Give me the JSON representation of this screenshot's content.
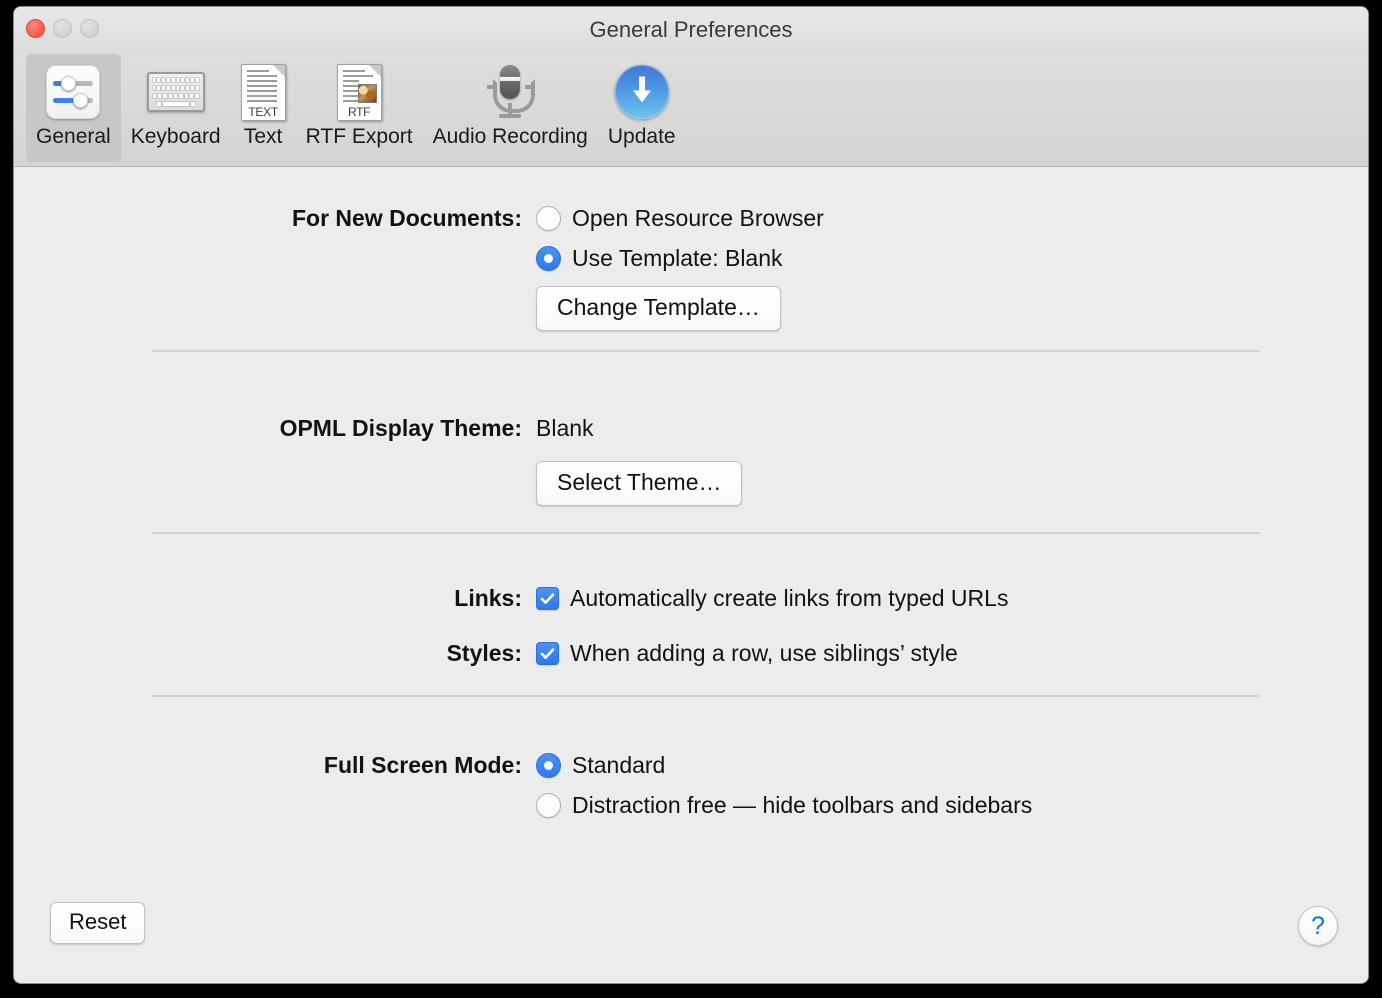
{
  "window": {
    "title": "General Preferences",
    "traffic_lights": [
      {
        "name": "close",
        "state": "active"
      },
      {
        "name": "minimize",
        "state": "disabled"
      },
      {
        "name": "zoom",
        "state": "disabled"
      }
    ]
  },
  "toolbar": {
    "selected": "General",
    "tabs": [
      {
        "label": "General",
        "icon": "sliders-icon",
        "selected": true
      },
      {
        "label": "Keyboard",
        "icon": "keyboard-icon",
        "selected": false
      },
      {
        "label": "Text",
        "icon": "text-document-icon",
        "selected": false
      },
      {
        "label": "RTF Export",
        "icon": "rtf-document-icon",
        "selected": false
      },
      {
        "label": "Audio Recording",
        "icon": "microphone-icon",
        "selected": false
      },
      {
        "label": "Update",
        "icon": "download-arrow-icon",
        "selected": false
      }
    ],
    "icon_tags": {
      "text": "TEXT",
      "rtf": "RTF"
    }
  },
  "sections": {
    "new_documents": {
      "label": "For New Documents:",
      "options": [
        {
          "label": "Open Resource Browser",
          "selected": false
        },
        {
          "label": "Use Template: Blank",
          "selected": true
        }
      ],
      "button": "Change Template…"
    },
    "opml_theme": {
      "label": "OPML Display Theme:",
      "value": "Blank",
      "button": "Select Theme…"
    },
    "links": {
      "label": "Links:",
      "checkbox_label": "Automatically create links from typed URLs",
      "checked": true
    },
    "styles": {
      "label": "Styles:",
      "checkbox_label": "When adding a row, use siblings’ style",
      "checked": true
    },
    "full_screen": {
      "label": "Full Screen Mode:",
      "options": [
        {
          "label": "Standard",
          "selected": true
        },
        {
          "label": "Distraction free — hide toolbars and sidebars",
          "selected": false
        }
      ]
    }
  },
  "footer": {
    "reset_label": "Reset",
    "help_label": "?"
  },
  "colors": {
    "accent_blue": "#3b80ef",
    "window_bg": "#ececec",
    "toolbar_bg": "#d8d8d8",
    "close_red": "#ff5f52",
    "help_blue": "#0b72e7"
  }
}
